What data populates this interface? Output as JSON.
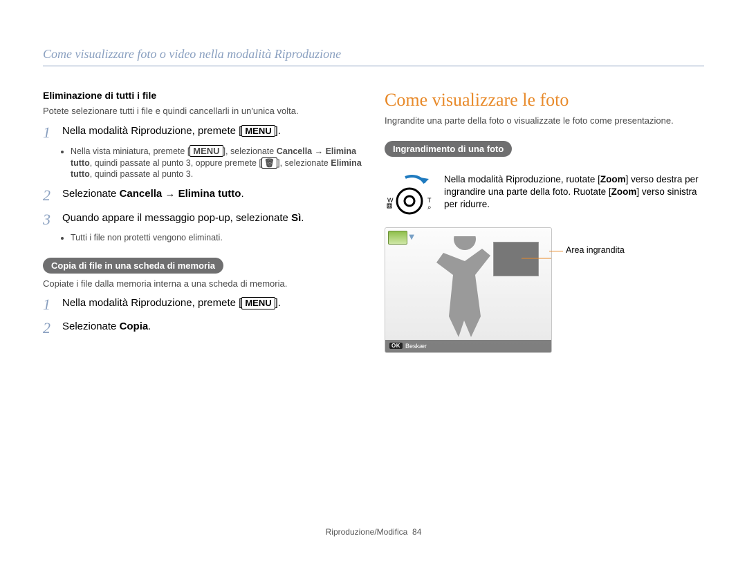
{
  "running_header": "Come visualizzare foto o video nella modalità Riproduzione",
  "left": {
    "h3_delete_all": "Eliminazione di tutti i file",
    "delete_all_desc": "Potete selezionare tutti i file e quindi cancellarli in un'unica volta.",
    "step1": {
      "pre": "Nella modalità Riproduzione, premete [",
      "btn": "MENU",
      "post": "]."
    },
    "step1_note": {
      "pre": "Nella vista miniatura, premete [",
      "btn1": "MENU",
      "mid1": "], selezionate ",
      "b1": "Cancella → Elimina tutto",
      "mid2": ", quindi passate al punto 3, oppure premete [",
      "icon": "🗑",
      "mid3": "], selezionate ",
      "b2": "Elimina tutto",
      "mid4": ", quindi passate al punto 3."
    },
    "step2": {
      "pre": "Selezionate ",
      "b": "Cancella → Elimina tutto",
      "post": "."
    },
    "step3": {
      "pre": "Quando appare il messaggio pop-up, selezionate ",
      "b": "Sì",
      "post": "."
    },
    "step3_note": "Tutti i file non protetti vengono eliminati.",
    "pill_copy": "Copia di file in una scheda di memoria",
    "copy_desc": "Copiate i file dalla memoria interna a una scheda di memoria.",
    "c_step1": {
      "pre": "Nella modalità Riproduzione, premete [",
      "btn": "MENU",
      "post": "]."
    },
    "c_step2": {
      "pre": "Selezionate ",
      "b": "Copia",
      "post": "."
    }
  },
  "right": {
    "title": "Come visualizzare le foto",
    "intro": "Ingrandite una parte della foto o visualizzate le foto come presentazione.",
    "pill_zoom": "Ingrandimento di una foto",
    "zoom_text": {
      "pre": "Nella modalità Riproduzione, ruotate [",
      "b1": "Zoom",
      "mid1": "] verso destra per ingrandire una parte della foto. Ruotate [",
      "b2": "Zoom",
      "mid2": "] verso sinistra per ridurre."
    },
    "screen": {
      "ok": "OK",
      "beskaer": "Beskær"
    },
    "label_area": "Area ingrandita"
  },
  "footer": {
    "text": "Riproduzione/Modifica",
    "page": "84"
  }
}
